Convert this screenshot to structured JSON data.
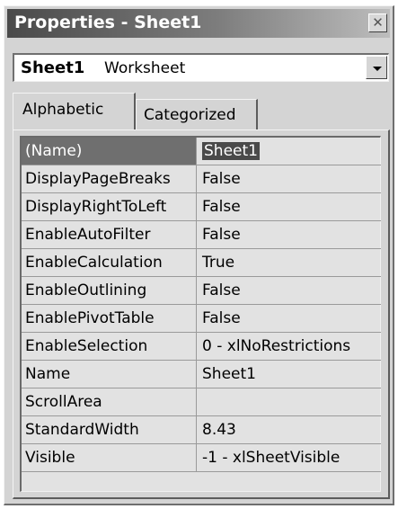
{
  "window": {
    "title": "Properties - Sheet1",
    "close_glyph": "✕",
    "close_icon": "close-icon"
  },
  "object_selector": {
    "name": "Sheet1",
    "type": "Worksheet",
    "dropdown_icon": "chevron-down-icon"
  },
  "tabs": [
    {
      "label": "Alphabetic",
      "active": true
    },
    {
      "label": "Categorized",
      "active": false
    }
  ],
  "properties": [
    {
      "name": "(Name)",
      "value": "Sheet1",
      "selected": true
    },
    {
      "name": "DisplayPageBreaks",
      "value": "False"
    },
    {
      "name": "DisplayRightToLeft",
      "value": "False"
    },
    {
      "name": "EnableAutoFilter",
      "value": "False"
    },
    {
      "name": "EnableCalculation",
      "value": "True"
    },
    {
      "name": "EnableOutlining",
      "value": "False"
    },
    {
      "name": "EnablePivotTable",
      "value": "False"
    },
    {
      "name": "EnableSelection",
      "value": "0 - xlNoRestrictions"
    },
    {
      "name": "Name",
      "value": "Sheet1"
    },
    {
      "name": "ScrollArea",
      "value": ""
    },
    {
      "name": "StandardWidth",
      "value": "8.43"
    },
    {
      "name": "Visible",
      "value": "-1 - xlSheetVisible"
    }
  ]
}
